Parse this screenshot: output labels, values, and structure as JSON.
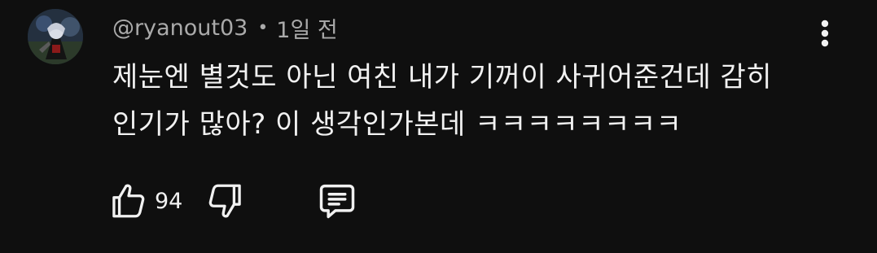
{
  "comment": {
    "author": "@ryanout03",
    "separator": "•",
    "time_ago": "1일 전",
    "text_lines": [
      "제눈엔 별것도 아닌 여친 내가 기꺼이 사귀어준건데 감히",
      "인기가 많아? 이 생각인가본데 ㅋㅋㅋㅋㅋㅋㅋㅋ"
    ],
    "like_count": "94"
  },
  "icons": {
    "like": "thumbs-up-icon",
    "dislike": "thumbs-down-icon",
    "reply": "reply-comment-icon",
    "menu": "more-vertical-icon"
  },
  "colors": {
    "background": "#0f0f0f",
    "primary_text": "#f1f1f1",
    "secondary_text": "#aaaaaa"
  }
}
